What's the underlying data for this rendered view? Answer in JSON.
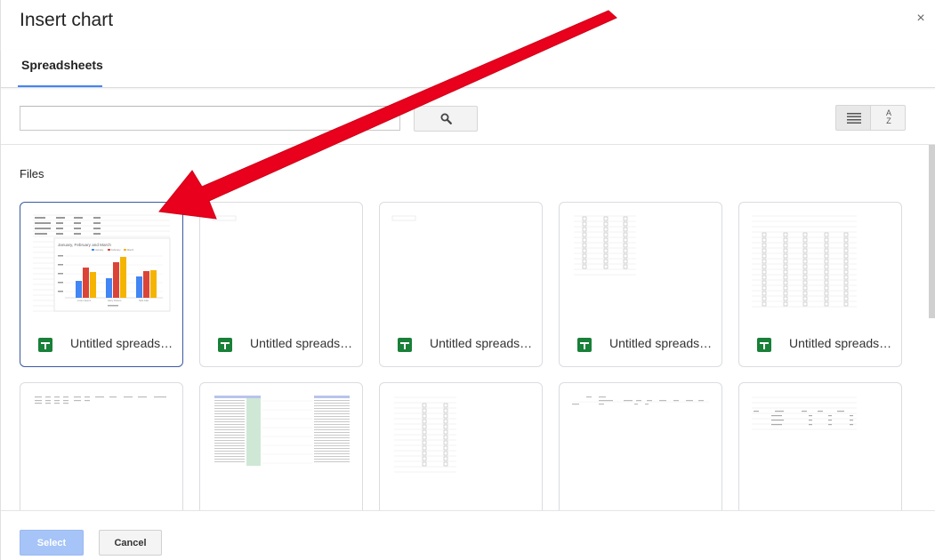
{
  "dialog": {
    "title": "Insert chart",
    "close_symbol": "×"
  },
  "tabs": [
    {
      "label": "Spreadsheets",
      "active": true
    }
  ],
  "search": {
    "value": "",
    "placeholder": "",
    "icon": "search-icon"
  },
  "toolbar": {
    "list_view_icon": "list-view-icon",
    "sort_icon": "sort-az-icon",
    "sort_text_top": "A",
    "sort_text_bottom": "Z"
  },
  "files": {
    "section_label": "Files",
    "items": [
      {
        "name": "Untitled spreadsh…",
        "selected": true
      },
      {
        "name": "Untitled spreadsh…",
        "selected": false
      },
      {
        "name": "Untitled spreadsh…",
        "selected": false
      },
      {
        "name": "Untitled spreadsh…",
        "selected": false
      },
      {
        "name": "Untitled spreadsh…",
        "selected": false
      }
    ]
  },
  "thumbnail_chart": {
    "title": "January, February and March",
    "legend": [
      "January",
      "February",
      "March"
    ],
    "colors": [
      "#4285f4",
      "#db4437",
      "#f4b400"
    ],
    "categories": [
      "Lorem Ipsum",
      "Harry Dotson",
      "Nick Julie"
    ]
  },
  "footer": {
    "select_label": "Select",
    "cancel_label": "Cancel"
  },
  "colors": {
    "accent": "#4285f4",
    "sheets_green": "#188038",
    "arrow_red": "#e8001c"
  }
}
